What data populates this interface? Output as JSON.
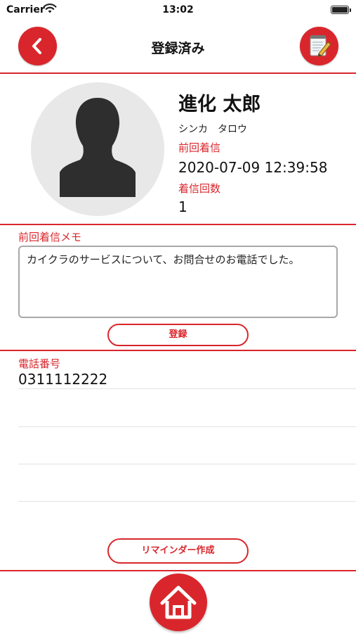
{
  "status_bar": {
    "carrier": "Carrier",
    "time": "13:02"
  },
  "header": {
    "title": "登録済み"
  },
  "profile": {
    "name": "進化 太郎",
    "kana": "シンカ　タロウ",
    "last_call_label": "前回着信",
    "last_call_value": "2020-07-09 12:39:58",
    "call_count_label": "着信回数",
    "call_count_value": "1"
  },
  "memo": {
    "label": "前回着信メモ",
    "text": "カイクラのサービスについて、お問合せのお電話でした。",
    "register_label": "登録"
  },
  "phone": {
    "label": "電話番号",
    "number": "0311112222"
  },
  "reminder": {
    "label": "リマインダー作成"
  },
  "colors": {
    "accent": "#d9262c",
    "avatar_bg": "#e8e8e8"
  },
  "icons": [
    "wifi-icon",
    "battery-icon",
    "back-chevron-icon",
    "edit-note-icon",
    "person-silhouette-icon",
    "home-icon"
  ]
}
